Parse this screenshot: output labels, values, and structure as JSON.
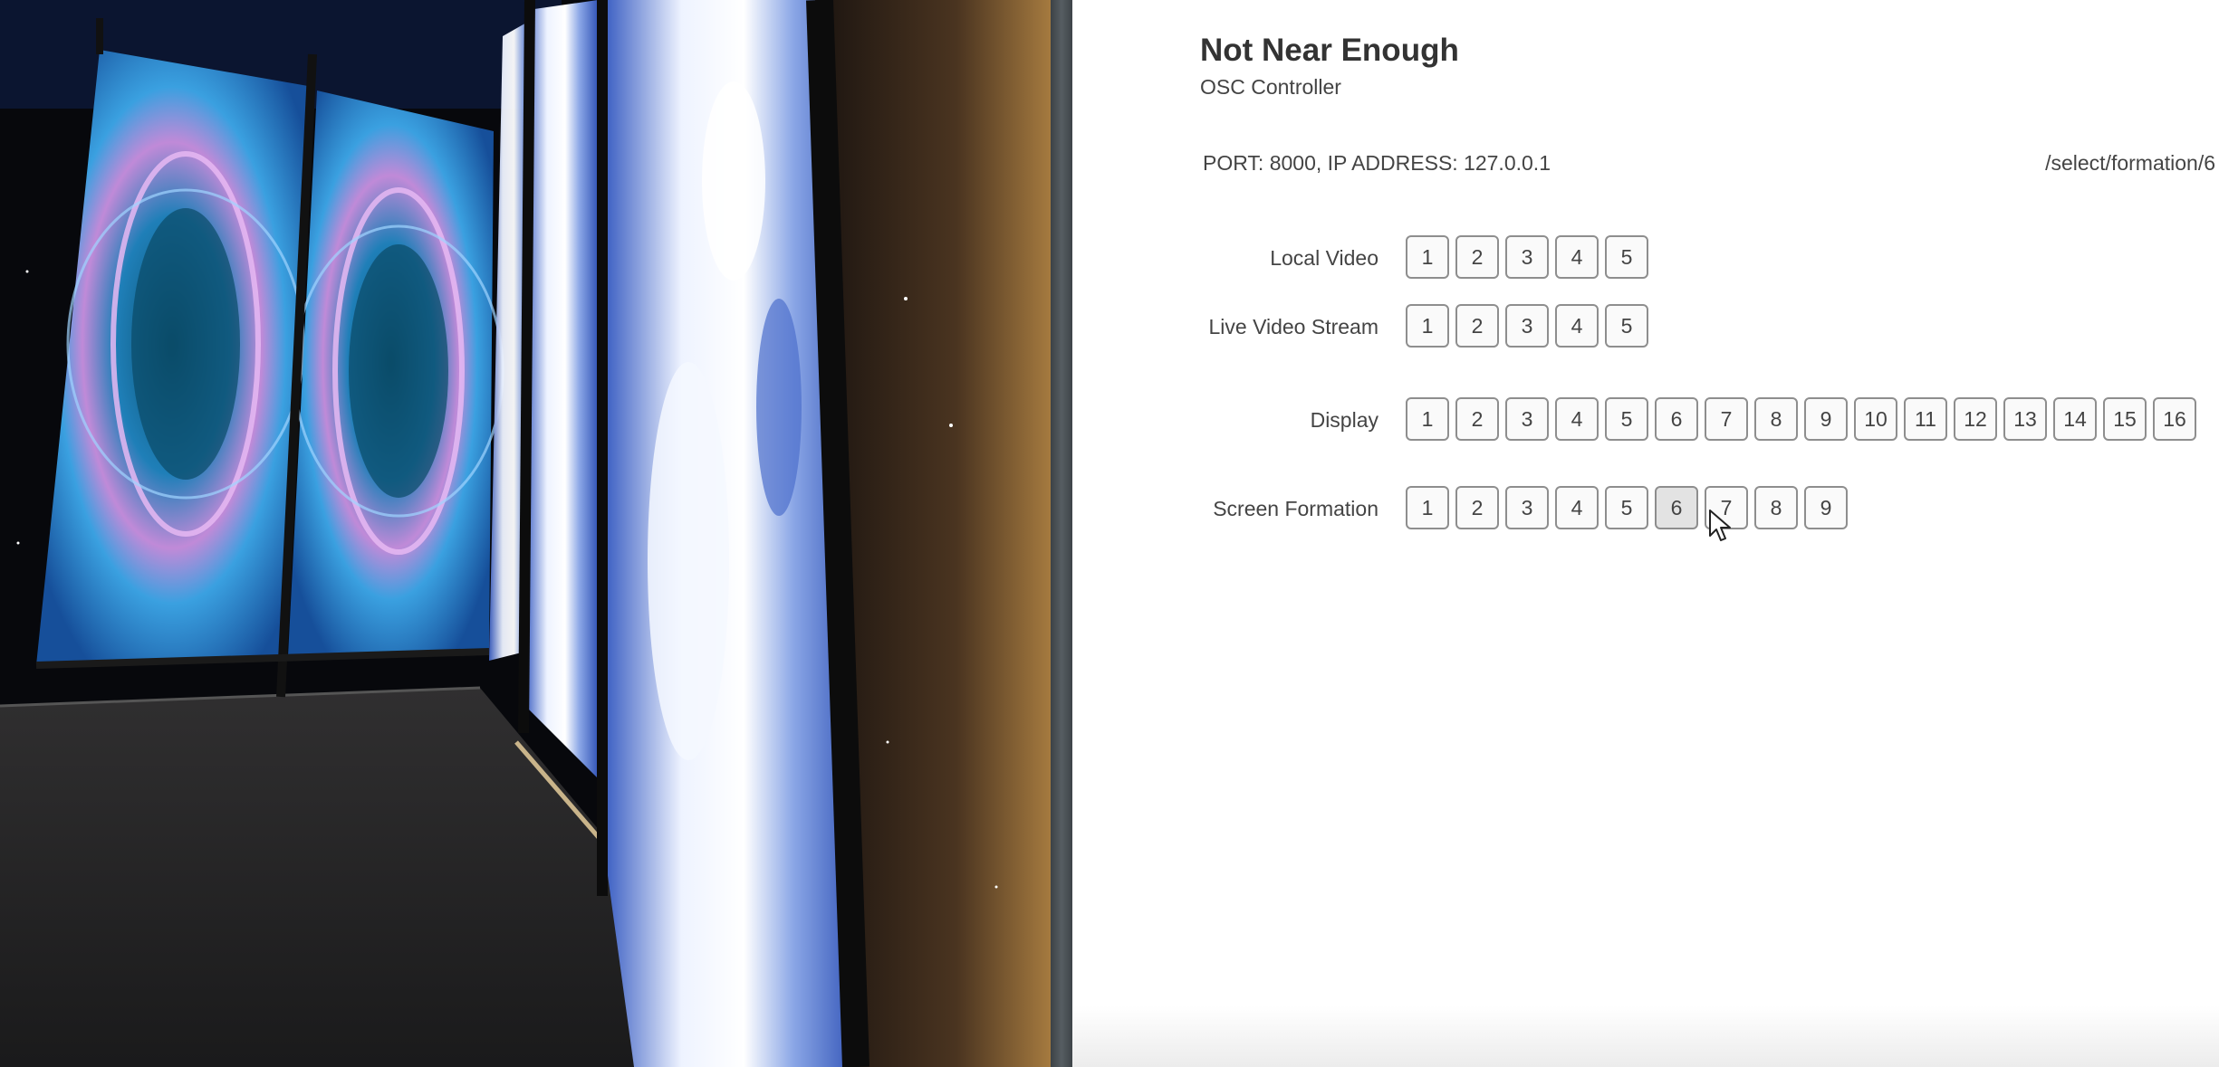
{
  "scene": {
    "name": "3D stage preview"
  },
  "panel": {
    "title": "Not Near Enough",
    "subtitle": "OSC Controller",
    "connection": "PORT: 8000, IP ADDRESS: 127.0.0.1",
    "last_message": "/select/formation/6"
  },
  "rows": {
    "local_video": {
      "label": "Local Video",
      "buttons": [
        "1",
        "2",
        "3",
        "4",
        "5"
      ]
    },
    "live_video_stream": {
      "label": "Live Video Stream",
      "buttons": [
        "1",
        "2",
        "3",
        "4",
        "5"
      ]
    },
    "display": {
      "label": "Display",
      "buttons": [
        "1",
        "2",
        "3",
        "4",
        "5",
        "6",
        "7",
        "8",
        "9",
        "10",
        "11",
        "12",
        "13",
        "14",
        "15",
        "16"
      ]
    },
    "screen_formation": {
      "label": "Screen Formation",
      "buttons": [
        "1",
        "2",
        "3",
        "4",
        "5",
        "6",
        "7",
        "8",
        "9"
      ],
      "active": "6"
    }
  },
  "icons": {
    "cursor": "mouse-pointer-icon"
  }
}
